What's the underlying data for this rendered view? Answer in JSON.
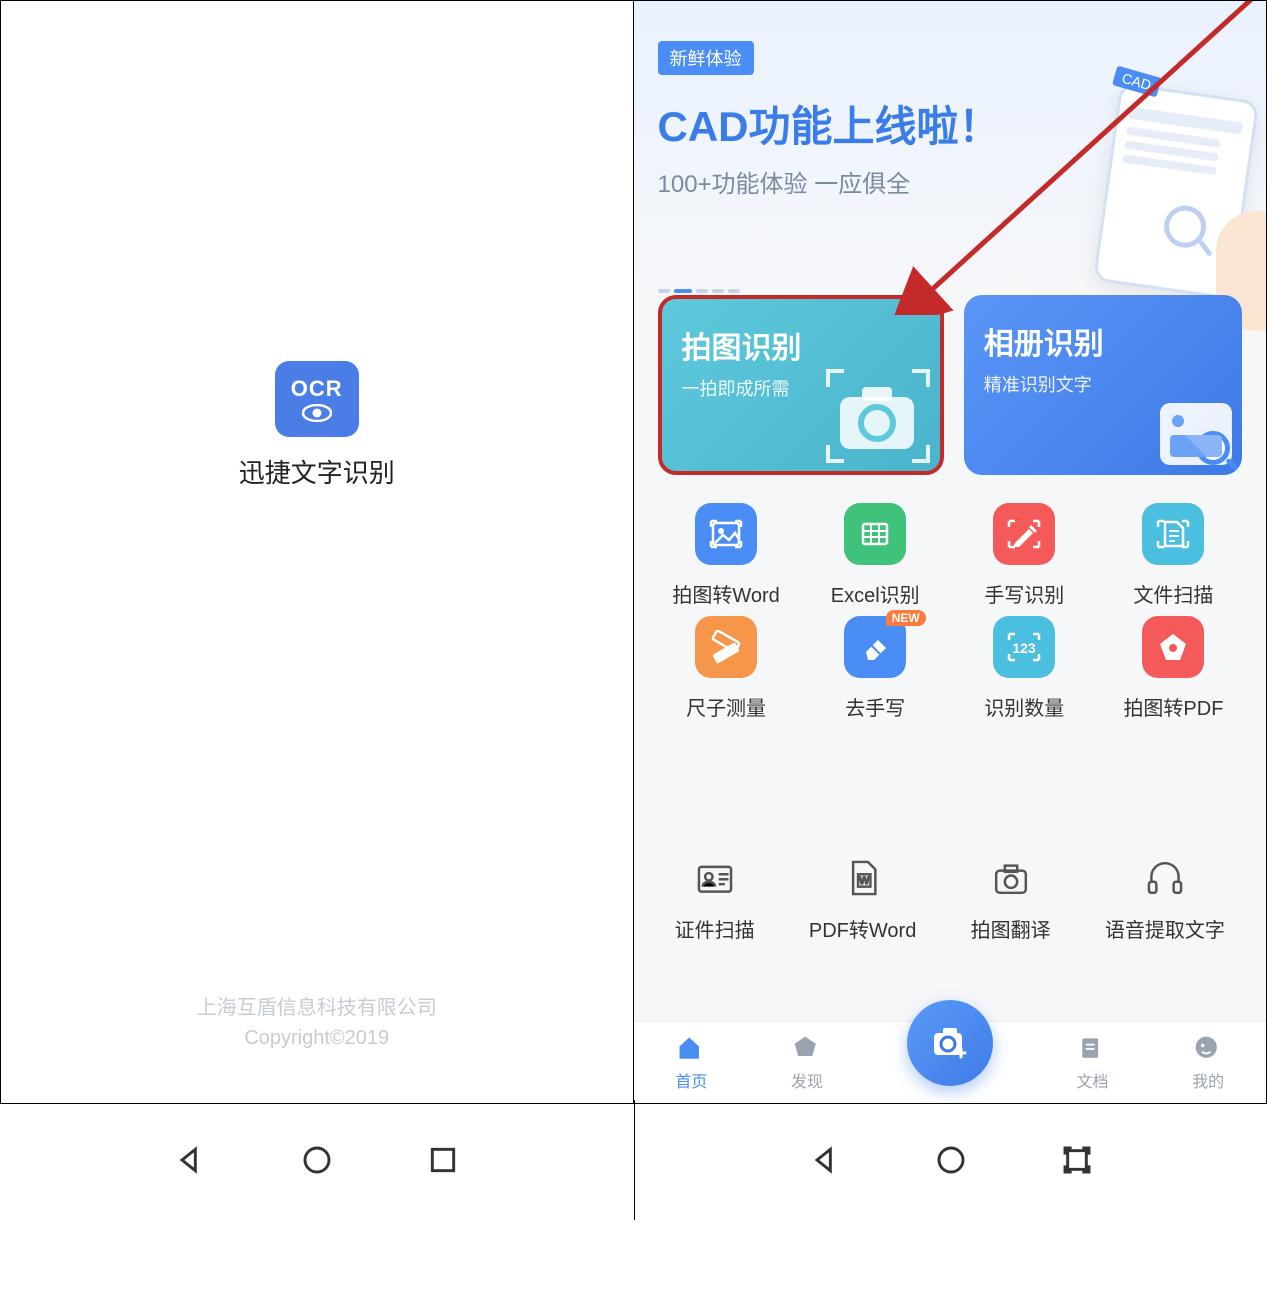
{
  "left": {
    "badge_text": "OCR",
    "app_name": "迅捷文字识别",
    "company": "上海互盾信息科技有限公司",
    "copyright": "Copyright©2019"
  },
  "right": {
    "hero": {
      "tag": "新鲜体验",
      "title": "CAD功能上线啦！",
      "subtitle": "100+功能体验  一应俱全",
      "phone_tag": "CAD"
    },
    "bigcards": {
      "camera": {
        "title": "拍图识别",
        "subtitle": "一拍即成所需"
      },
      "album": {
        "title": "相册识别",
        "subtitle": "精准识别文字"
      }
    },
    "grid": [
      {
        "label": "拍图转Word",
        "color": "blue",
        "icon": "image"
      },
      {
        "label": "Excel识别",
        "color": "green",
        "icon": "grid"
      },
      {
        "label": "手写识别",
        "color": "red",
        "icon": "pen"
      },
      {
        "label": "文件扫描",
        "color": "teal",
        "icon": "doc"
      },
      {
        "label": "尺子测量",
        "color": "orange",
        "icon": "ruler"
      },
      {
        "label": "去手写",
        "color": "blue",
        "icon": "eraser",
        "badge": "NEW"
      },
      {
        "label": "识别数量",
        "color": "teal",
        "icon": "123"
      },
      {
        "label": "拍图转PDF",
        "color": "red",
        "icon": "pdf"
      }
    ],
    "secondary": [
      {
        "label": "证件扫描",
        "icon": "id"
      },
      {
        "label": "PDF转Word",
        "icon": "word"
      },
      {
        "label": "拍图翻译",
        "icon": "camera"
      },
      {
        "label": "语音提取文字",
        "icon": "headphone"
      }
    ],
    "nav": [
      {
        "label": "首页",
        "active": true,
        "icon": "home"
      },
      {
        "label": "发现",
        "active": false,
        "icon": "discover"
      },
      {
        "label": "文档",
        "active": false,
        "icon": "docs"
      },
      {
        "label": "我的",
        "active": false,
        "icon": "me"
      }
    ]
  }
}
